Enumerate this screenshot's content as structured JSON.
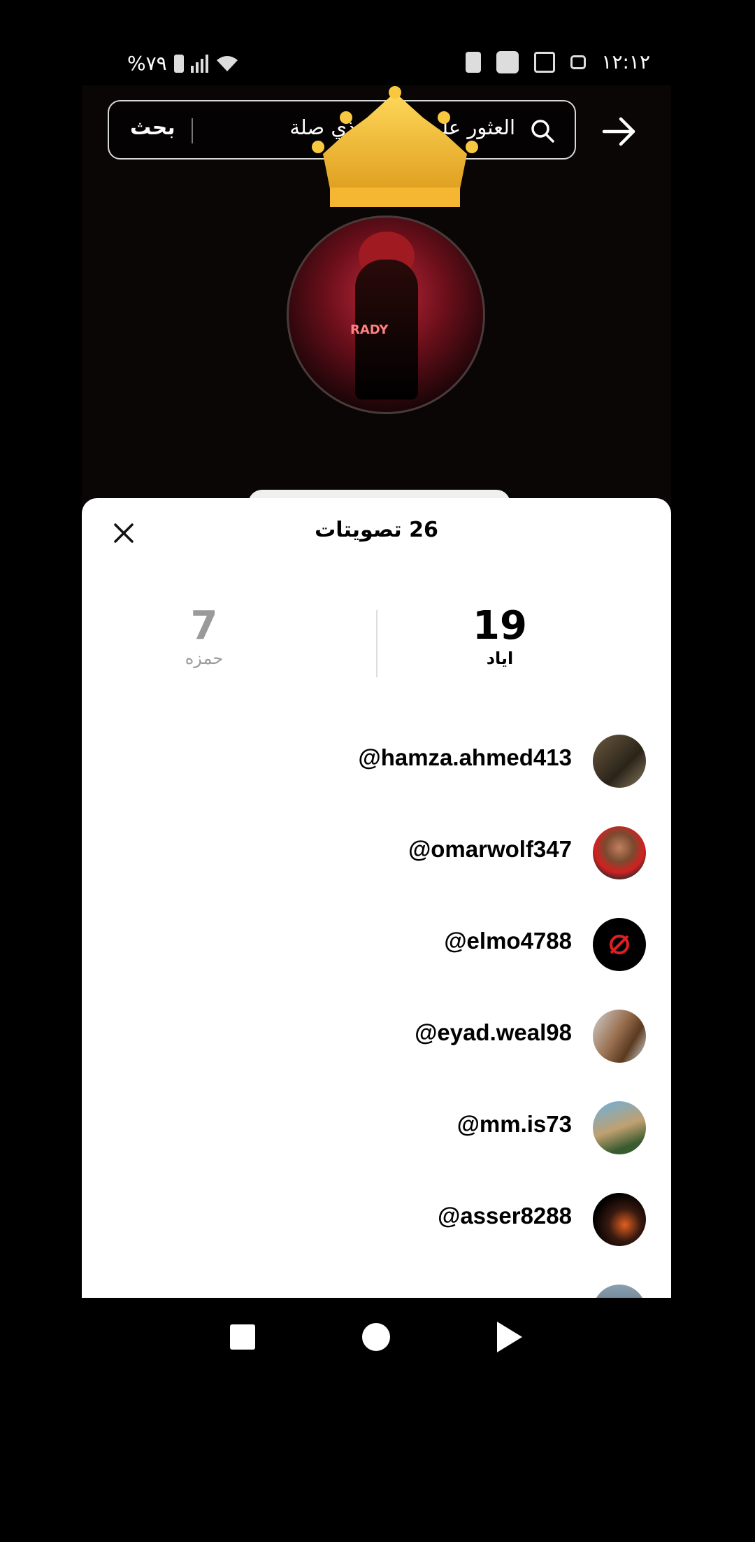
{
  "status_bar": {
    "battery_text": "%٧٩",
    "time": "١٢:١٢"
  },
  "search": {
    "button_label": "بحث",
    "placeholder": "العثور على محتوى ذي صلة"
  },
  "profile": {
    "avatar_text": "RADY"
  },
  "sheet": {
    "title": "26 تصويتات",
    "tallies": [
      {
        "count": "19",
        "name": "اياد"
      },
      {
        "count": "7",
        "name": "حمزه"
      }
    ],
    "voters": [
      {
        "handle": "@hamza.ahmed413"
      },
      {
        "handle": "@omarwolf347"
      },
      {
        "handle": "@elmo4788"
      },
      {
        "handle": "@eyad.weal98"
      },
      {
        "handle": "@mm.is73"
      },
      {
        "handle": "@asser8288"
      }
    ]
  },
  "colors": {
    "sheet_bg": "#ffffff",
    "screen_bg": "#000000",
    "crown_gold": "#f2c230"
  }
}
